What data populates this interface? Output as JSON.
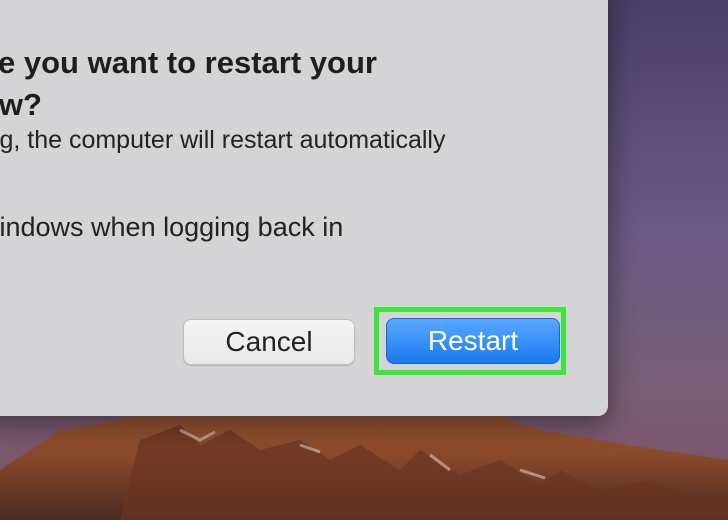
{
  "dialog": {
    "title_line1": "e you want to restart your",
    "title_line2": "ow?",
    "message_line1": "ing, the computer will restart automatically",
    "message_line2": ".",
    "checkbox_label": "windows when logging back in",
    "cancel_label": "Cancel",
    "restart_label": "Restart"
  },
  "colors": {
    "primary_button": "#1a78f0",
    "highlight": "#3ce43c",
    "dialog_bg": "#d4d3d6"
  }
}
